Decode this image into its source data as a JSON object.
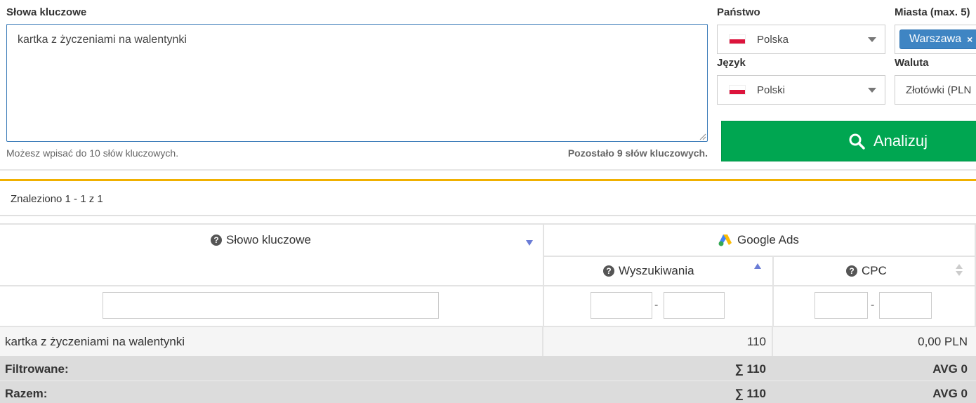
{
  "keywords": {
    "label": "Słowa kluczowe",
    "value": "kartka z życzeniami na walentynki",
    "hint_left": "Możesz wpisać do 10 słów kluczowych.",
    "hint_right": "Pozostało 9 słów kluczowych."
  },
  "country": {
    "label": "Państwo",
    "value": "Polska"
  },
  "cities": {
    "label": "Miasta (max. 5)",
    "tags": [
      "Warszawa"
    ],
    "remove_symbol": "×"
  },
  "language": {
    "label": "Język",
    "value": "Polski"
  },
  "currency": {
    "label": "Waluta",
    "value": "Złotówki (PLN"
  },
  "analyze_button": {
    "label": "Analizuj",
    "icon": "search-icon"
  },
  "results": {
    "found_text": "Znaleziono 1 - 1 z 1"
  },
  "table": {
    "col_keyword": "Słowo kluczowe",
    "group_google": "Google Ads",
    "col_searches": "Wyszukiwania",
    "col_cpc": "CPC",
    "range_separator": "-",
    "rows": [
      {
        "keyword": "kartka z życzeniami na walentynki",
        "searches": "110",
        "cpc": "0,00 PLN"
      }
    ],
    "filtered": {
      "label": "Filtrowane:",
      "searches": "∑ 110",
      "cpc": "AVG 0"
    },
    "total": {
      "label": "Razem:",
      "searches": "∑ 110",
      "cpc": "AVG 0"
    }
  },
  "colors": {
    "accent_green": "#00a651",
    "tag_blue": "#3f85c3",
    "divider_orange": "#f0b000",
    "sort_active": "#6a7cd6"
  }
}
